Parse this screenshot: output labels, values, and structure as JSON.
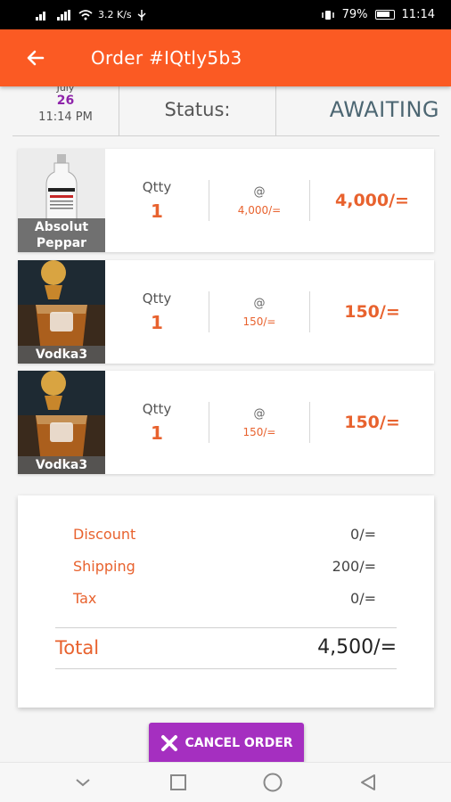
{
  "status_bar": {
    "network": "3.2 K/s",
    "battery": "79%",
    "time": "11:14",
    "icons": [
      "signal-icon",
      "wifi-icon",
      "usb-icon",
      "vibrate-icon",
      "battery-icon"
    ]
  },
  "header": {
    "title": "Order #IQtly5b3",
    "back_icon": "arrow-left-icon",
    "bg_color": "#fb5a23"
  },
  "order_info": {
    "month": "July",
    "day": "26",
    "time": "11:14 PM",
    "status_label": "Status:",
    "status_value": "AWAITING"
  },
  "items": [
    {
      "name": "Absolut Peppar",
      "qty_label": "Qtty",
      "qty": "1",
      "at": "@",
      "unit_price": "4,000/=",
      "line_total": "4,000/="
    },
    {
      "name": "Vodka3",
      "qty_label": "Qtty",
      "qty": "1",
      "at": "@",
      "unit_price": "150/=",
      "line_total": "150/="
    },
    {
      "name": "Vodka3",
      "qty_label": "Qtty",
      "qty": "1",
      "at": "@",
      "unit_price": "150/=",
      "line_total": "150/="
    }
  ],
  "summary": {
    "discount_label": "Discount",
    "discount_value": "0/=",
    "shipping_label": "Shipping",
    "shipping_value": "200/=",
    "tax_label": "Tax",
    "tax_value": "0/=",
    "total_label": "Total",
    "total_value": "4,500/="
  },
  "actions": {
    "cancel_label": "CANCEL ORDER",
    "cancel_color": "#a52fc0"
  },
  "colors": {
    "accent": "#e8622e",
    "status": "#4c6672",
    "date_day": "#8e24aa"
  }
}
